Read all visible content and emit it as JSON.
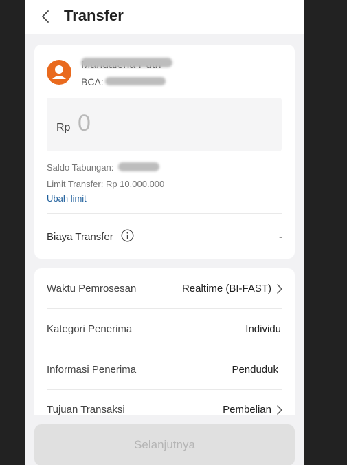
{
  "header": {
    "title": "Transfer"
  },
  "recipient": {
    "name": "Mandalena Putri",
    "bank_label": "BCA:"
  },
  "amount": {
    "currency": "Rp",
    "value": "0"
  },
  "balance": {
    "saldo_label": "Saldo Tabungan:",
    "limit_text": "Limit Transfer: Rp 10.000.000",
    "change_limit_link": "Ubah limit"
  },
  "fee": {
    "label": "Biaya Transfer",
    "value": "-"
  },
  "details": {
    "rows": [
      {
        "label": "Waktu Pemrosesan",
        "value": "Realtime (BI-FAST)"
      },
      {
        "label": "Kategori Penerima",
        "value": "Individu"
      },
      {
        "label": "Informasi Penerima",
        "value": "Penduduk"
      },
      {
        "label": "Tujuan Transaksi",
        "value": "Pembelian"
      }
    ]
  },
  "footer": {
    "next_label": "Selanjutnya"
  },
  "colors": {
    "avatar": "#e96a1e",
    "link": "#1f5f9c"
  },
  "icons": {
    "back": "chevron-left-icon",
    "avatar": "user-avatar-icon",
    "info": "info-icon",
    "chevron": "chevron-right-icon"
  }
}
